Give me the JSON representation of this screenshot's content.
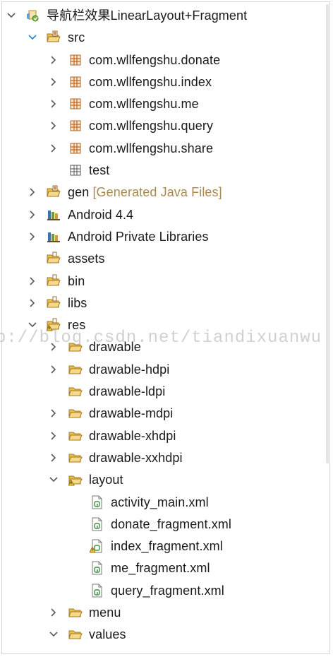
{
  "tree": {
    "rows": [
      {
        "name": "project-root",
        "depth": 0,
        "arrow": "down",
        "icon": "project-icon",
        "label": "导航栏效果LinearLayout+Fragment"
      },
      {
        "name": "folder-src",
        "depth": 1,
        "arrow": "down-blue",
        "icon": "source-folder-open-icon",
        "label": "src"
      },
      {
        "name": "package-donate",
        "depth": 2,
        "arrow": "right",
        "icon": "package-icon",
        "label": "com.wllfengshu.donate"
      },
      {
        "name": "package-index",
        "depth": 2,
        "arrow": "right",
        "icon": "package-icon",
        "label": "com.wllfengshu.index"
      },
      {
        "name": "package-me",
        "depth": 2,
        "arrow": "right",
        "icon": "package-icon",
        "label": "com.wllfengshu.me"
      },
      {
        "name": "package-query",
        "depth": 2,
        "arrow": "right",
        "icon": "package-icon",
        "label": "com.wllfengshu.query"
      },
      {
        "name": "package-share",
        "depth": 2,
        "arrow": "right",
        "icon": "package-icon",
        "label": "com.wllfengshu.share"
      },
      {
        "name": "package-test",
        "depth": 2,
        "arrow": "none",
        "icon": "empty-package-icon",
        "label": "test"
      },
      {
        "name": "folder-gen",
        "depth": 1,
        "arrow": "right",
        "icon": "source-folder-icon",
        "label": "gen",
        "decoration": "[Generated Java Files]"
      },
      {
        "name": "library-android",
        "depth": 1,
        "arrow": "right",
        "icon": "library-icon",
        "label": "Android 4.4"
      },
      {
        "name": "library-private",
        "depth": 1,
        "arrow": "right",
        "icon": "library-icon",
        "label": "Android Private Libraries"
      },
      {
        "name": "folder-assets",
        "depth": 1,
        "arrow": "none",
        "icon": "folder-icon",
        "label": "assets"
      },
      {
        "name": "folder-bin",
        "depth": 1,
        "arrow": "right",
        "icon": "folder-icon",
        "label": "bin"
      },
      {
        "name": "folder-libs",
        "depth": 1,
        "arrow": "right",
        "icon": "folder-icon",
        "label": "libs"
      },
      {
        "name": "folder-res",
        "depth": 1,
        "arrow": "down",
        "icon": "folder-warning-icon",
        "label": "res"
      },
      {
        "name": "folder-drawable",
        "depth": 2,
        "arrow": "right",
        "icon": "folder-open-icon",
        "label": "drawable"
      },
      {
        "name": "folder-drawable-hdpi",
        "depth": 2,
        "arrow": "right",
        "icon": "folder-open-icon",
        "label": "drawable-hdpi"
      },
      {
        "name": "folder-drawable-ldpi",
        "depth": 2,
        "arrow": "none",
        "icon": "folder-open-icon",
        "label": "drawable-ldpi"
      },
      {
        "name": "folder-drawable-mdpi",
        "depth": 2,
        "arrow": "right",
        "icon": "folder-open-icon",
        "label": "drawable-mdpi"
      },
      {
        "name": "folder-drawable-xhdpi",
        "depth": 2,
        "arrow": "right",
        "icon": "folder-open-icon",
        "label": "drawable-xhdpi"
      },
      {
        "name": "folder-drawable-xxhdpi",
        "depth": 2,
        "arrow": "right",
        "icon": "folder-open-icon",
        "label": "drawable-xxhdpi"
      },
      {
        "name": "folder-layout",
        "depth": 2,
        "arrow": "down",
        "icon": "folder-open-warning-icon",
        "label": "layout"
      },
      {
        "name": "file-activity-main",
        "depth": 3,
        "arrow": "none",
        "icon": "xml-file-icon",
        "label": "activity_main.xml"
      },
      {
        "name": "file-donate-fragment",
        "depth": 3,
        "arrow": "none",
        "icon": "xml-file-icon",
        "label": "donate_fragment.xml"
      },
      {
        "name": "file-index-fragment",
        "depth": 3,
        "arrow": "none",
        "icon": "xml-file-warning-icon",
        "label": "index_fragment.xml"
      },
      {
        "name": "file-me-fragment",
        "depth": 3,
        "arrow": "none",
        "icon": "xml-file-icon",
        "label": "me_fragment.xml"
      },
      {
        "name": "file-query-fragment",
        "depth": 3,
        "arrow": "none",
        "icon": "xml-file-icon",
        "label": "query_fragment.xml"
      },
      {
        "name": "folder-menu",
        "depth": 2,
        "arrow": "right",
        "icon": "folder-open-icon",
        "label": "menu"
      },
      {
        "name": "folder-values",
        "depth": 2,
        "arrow": "down",
        "icon": "folder-open-icon",
        "label": "values"
      }
    ]
  },
  "watermark": "p://blog.csdn.net/tiandixuanwu",
  "colors": {
    "arrow": "#5a5a5a",
    "arrow_active": "#2a8bd8",
    "folder": "#d9a53c",
    "decoration": "#a88a4e"
  }
}
